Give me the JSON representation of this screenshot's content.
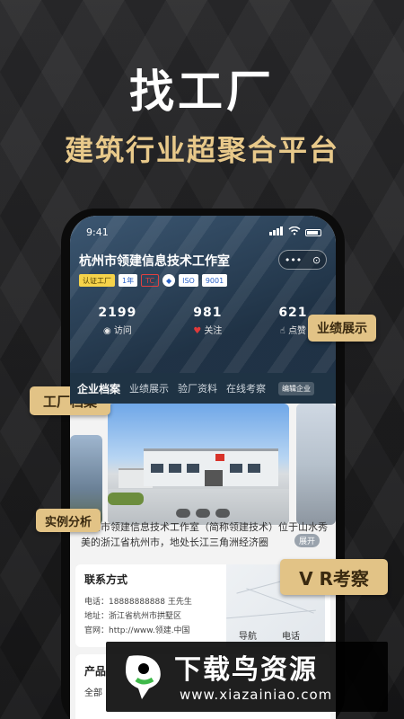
{
  "promo": {
    "headline": "找工厂",
    "subline": "建筑行业超聚合平台"
  },
  "phone": {
    "status_time": "9:41",
    "company_name": "杭州市领建信息技术工作室",
    "capsule_more": "•••",
    "capsule_close": "⊙",
    "badges": {
      "certified": "认证工厂",
      "years": "1年",
      "red": "TC",
      "iso": "ISO",
      "iso_num": "9001"
    },
    "stats": [
      {
        "value": "2199",
        "label": "访问",
        "icon": "eye-icon"
      },
      {
        "value": "981",
        "label": "关注",
        "icon": "heart-icon"
      },
      {
        "value": "621",
        "label": "点赞",
        "icon": "thumbs-up-icon"
      }
    ],
    "tabs": [
      "企业档案",
      "业绩展示",
      "验厂资料",
      "在线考察"
    ],
    "edit_label": "编辑企业",
    "intro_text": "杭州市领建信息技术工作室（简称领建技术）位于山水秀美的浙江省杭州市，地处长江三角洲经济圈",
    "more_label": "展开",
    "contact": {
      "title": "联系方式",
      "phone_line": "电话：18888888888 王先生",
      "address_line": "地址：浙江省杭州市拱墅区",
      "website_line": "官网：http://www.领建.中国",
      "nav_label": "导航",
      "call_label": "电话"
    },
    "products": {
      "title": "产品",
      "all_label": "全部"
    }
  },
  "callouts": {
    "performance": "业绩展示",
    "factory_archive": "工厂档案",
    "case_analysis": "实例分析",
    "vr_inspection": "V R考察"
  },
  "watermark": {
    "brand": "下载鸟资源",
    "url": "www.xiazainiao.com"
  },
  "colors": {
    "gold": "#e2c386",
    "headline_gold": "#e8c98a",
    "hero_blue": "#1f3344"
  }
}
